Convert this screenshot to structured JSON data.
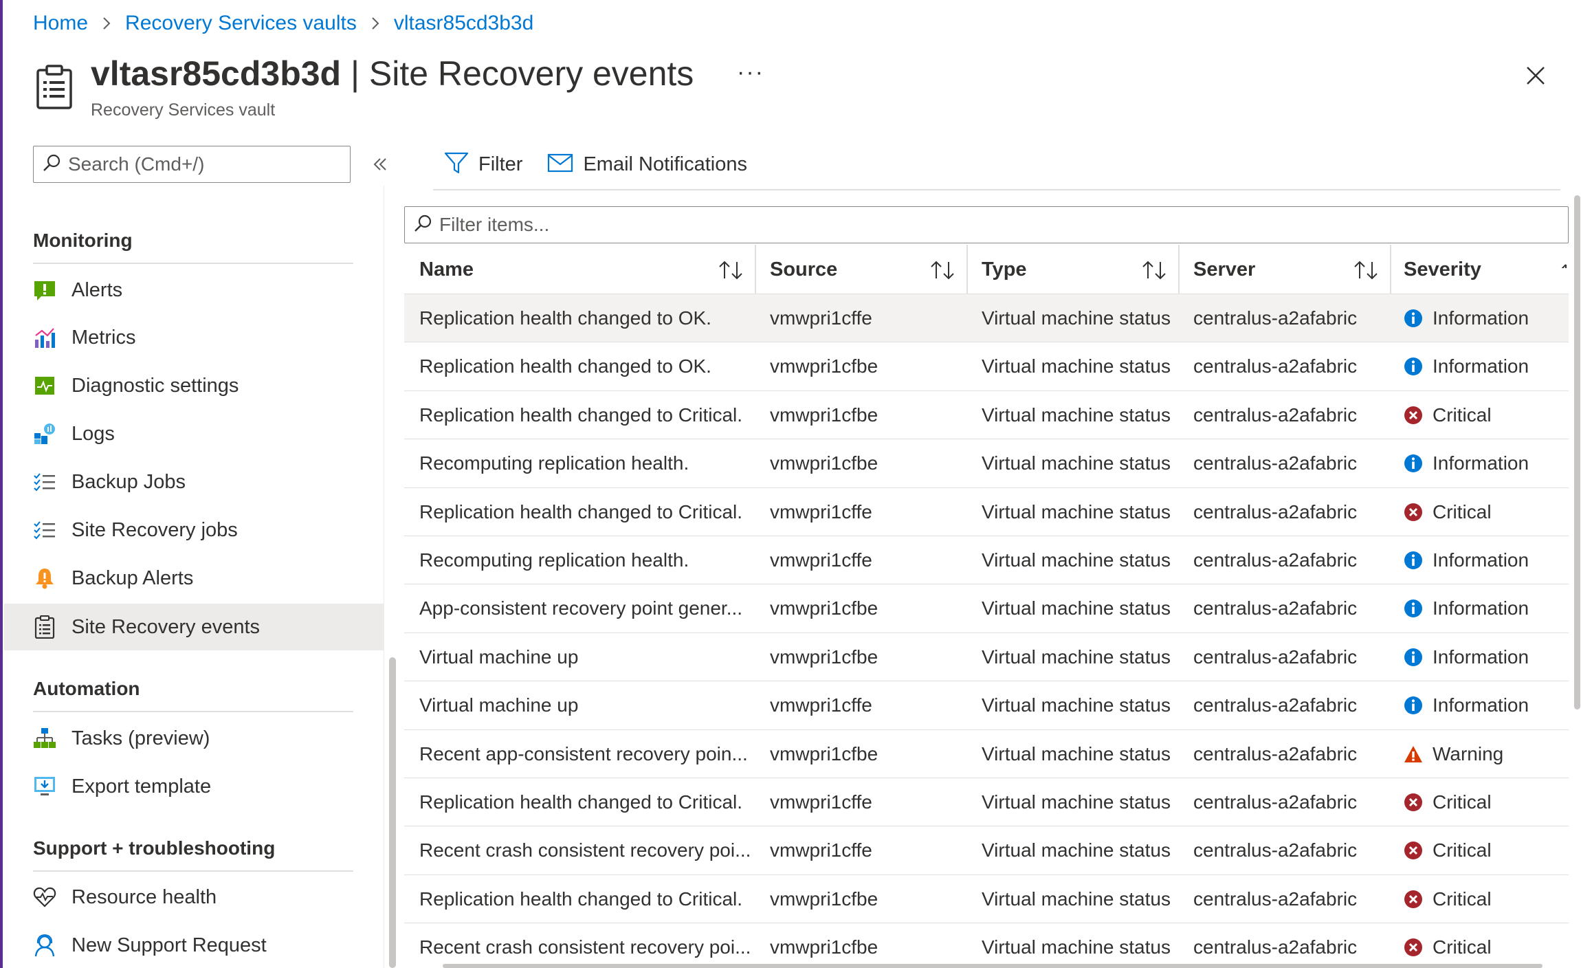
{
  "breadcrumb": {
    "items": [
      "Home",
      "Recovery Services vaults",
      "vltasr85cd3b3d"
    ]
  },
  "header": {
    "resource_name": "vltasr85cd3b3d",
    "separator": " | ",
    "blade_title": "Site Recovery events",
    "subtitle": "Recovery Services vault",
    "more_label": "···"
  },
  "sidebar": {
    "search_placeholder": "Search (Cmd+/)",
    "sections": [
      {
        "title": "Monitoring",
        "items": [
          {
            "label": "Alerts",
            "icon": "alert-icon"
          },
          {
            "label": "Metrics",
            "icon": "metrics-icon"
          },
          {
            "label": "Diagnostic settings",
            "icon": "diagnostic-icon"
          },
          {
            "label": "Logs",
            "icon": "logs-icon"
          },
          {
            "label": "Backup Jobs",
            "icon": "jobs-list-icon"
          },
          {
            "label": "Site Recovery jobs",
            "icon": "jobs-list-icon"
          },
          {
            "label": "Backup Alerts",
            "icon": "bell-icon"
          },
          {
            "label": "Site Recovery events",
            "icon": "clipboard-icon",
            "active": true
          }
        ]
      },
      {
        "title": "Automation",
        "items": [
          {
            "label": "Tasks (preview)",
            "icon": "tasks-icon"
          },
          {
            "label": "Export template",
            "icon": "export-icon"
          }
        ]
      },
      {
        "title": "Support + troubleshooting",
        "items": [
          {
            "label": "Resource health",
            "icon": "heart-pulse-icon"
          },
          {
            "label": "New Support Request",
            "icon": "support-person-icon"
          }
        ]
      }
    ]
  },
  "toolbar": {
    "filter_label": "Filter",
    "email_label": "Email Notifications"
  },
  "grid": {
    "filter_placeholder": "Filter items...",
    "columns": [
      "Name",
      "Source",
      "Type",
      "Server",
      "Severity"
    ],
    "rows": [
      {
        "name": "Replication health changed to OK.",
        "source": "vmwpri1cffe",
        "type": "Virtual machine status",
        "server": "centralus-a2afabric",
        "severity": "Information"
      },
      {
        "name": "Replication health changed to OK.",
        "source": "vmwpri1cfbe",
        "type": "Virtual machine status",
        "server": "centralus-a2afabric",
        "severity": "Information"
      },
      {
        "name": "Replication health changed to Critical.",
        "source": "vmwpri1cfbe",
        "type": "Virtual machine status",
        "server": "centralus-a2afabric",
        "severity": "Critical"
      },
      {
        "name": "Recomputing replication health.",
        "source": "vmwpri1cfbe",
        "type": "Virtual machine status",
        "server": "centralus-a2afabric",
        "severity": "Information"
      },
      {
        "name": "Replication health changed to Critical.",
        "source": "vmwpri1cffe",
        "type": "Virtual machine status",
        "server": "centralus-a2afabric",
        "severity": "Critical"
      },
      {
        "name": "Recomputing replication health.",
        "source": "vmwpri1cffe",
        "type": "Virtual machine status",
        "server": "centralus-a2afabric",
        "severity": "Information"
      },
      {
        "name": "App-consistent recovery point gener...",
        "source": "vmwpri1cfbe",
        "type": "Virtual machine status",
        "server": "centralus-a2afabric",
        "severity": "Information"
      },
      {
        "name": "Virtual machine up",
        "source": "vmwpri1cfbe",
        "type": "Virtual machine status",
        "server": "centralus-a2afabric",
        "severity": "Information"
      },
      {
        "name": "Virtual machine up",
        "source": "vmwpri1cffe",
        "type": "Virtual machine status",
        "server": "centralus-a2afabric",
        "severity": "Information"
      },
      {
        "name": "Recent app-consistent recovery poin...",
        "source": "vmwpri1cfbe",
        "type": "Virtual machine status",
        "server": "centralus-a2afabric",
        "severity": "Warning"
      },
      {
        "name": "Replication health changed to Critical.",
        "source": "vmwpri1cffe",
        "type": "Virtual machine status",
        "server": "centralus-a2afabric",
        "severity": "Critical"
      },
      {
        "name": "Recent crash consistent recovery poi...",
        "source": "vmwpri1cffe",
        "type": "Virtual machine status",
        "server": "centralus-a2afabric",
        "severity": "Critical"
      },
      {
        "name": "Replication health changed to Critical.",
        "source": "vmwpri1cfbe",
        "type": "Virtual machine status",
        "server": "centralus-a2afabric",
        "severity": "Critical"
      },
      {
        "name": "Recent crash consistent recovery poi...",
        "source": "vmwpri1cfbe",
        "type": "Virtual machine status",
        "server": "centralus-a2afabric",
        "severity": "Critical"
      }
    ]
  },
  "colors": {
    "link": "#0078d4",
    "info": "#0078d4",
    "critical": "#a4262c",
    "warning": "#d83b01",
    "active_nav_bg": "#edebe9",
    "selected_row_bg": "#f3f2f1"
  }
}
